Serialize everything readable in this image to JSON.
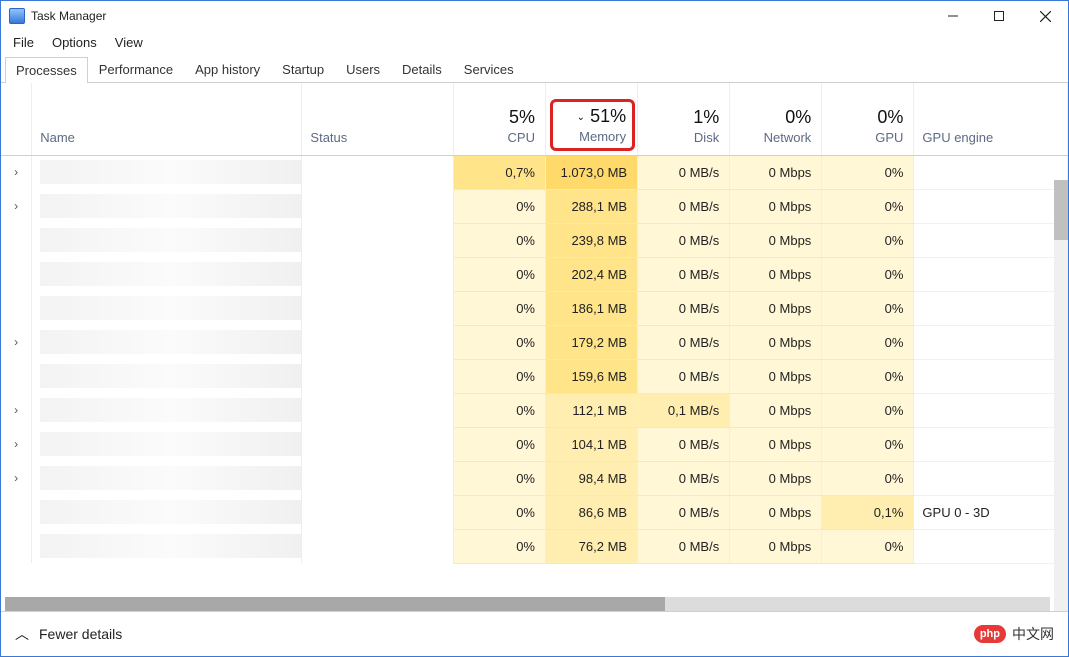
{
  "window": {
    "title": "Task Manager"
  },
  "menu": [
    "File",
    "Options",
    "View"
  ],
  "tabs": [
    "Processes",
    "Performance",
    "App history",
    "Startup",
    "Users",
    "Details",
    "Services"
  ],
  "active_tab": 0,
  "columns": {
    "name": {
      "label": "Name"
    },
    "status": {
      "label": "Status"
    },
    "cpu": {
      "usage": "5%",
      "label": "CPU"
    },
    "memory": {
      "usage": "51%",
      "label": "Memory",
      "sorted": true
    },
    "disk": {
      "usage": "1%",
      "label": "Disk"
    },
    "network": {
      "usage": "0%",
      "label": "Network"
    },
    "gpu": {
      "usage": "0%",
      "label": "GPU"
    },
    "engine": {
      "label": "GPU engine"
    }
  },
  "rows": [
    {
      "expand": true,
      "cpu": "0,7%",
      "mem": "1.073,0 MB",
      "disk": "0 MB/s",
      "net": "0 Mbps",
      "gpu": "0%",
      "eng": "",
      "h": {
        "cpu": "heat2",
        "mem": "heat3",
        "disk": "heat0",
        "net": "heat0",
        "gpu": "heat0"
      }
    },
    {
      "expand": true,
      "cpu": "0%",
      "mem": "288,1 MB",
      "disk": "0 MB/s",
      "net": "0 Mbps",
      "gpu": "0%",
      "eng": "",
      "h": {
        "cpu": "heat0",
        "mem": "heat2",
        "disk": "heat0",
        "net": "heat0",
        "gpu": "heat0"
      }
    },
    {
      "expand": false,
      "cpu": "0%",
      "mem": "239,8 MB",
      "disk": "0 MB/s",
      "net": "0 Mbps",
      "gpu": "0%",
      "eng": "",
      "h": {
        "cpu": "heat0",
        "mem": "heat2",
        "disk": "heat0",
        "net": "heat0",
        "gpu": "heat0"
      }
    },
    {
      "expand": false,
      "cpu": "0%",
      "mem": "202,4 MB",
      "disk": "0 MB/s",
      "net": "0 Mbps",
      "gpu": "0%",
      "eng": "",
      "h": {
        "cpu": "heat0",
        "mem": "heat2",
        "disk": "heat0",
        "net": "heat0",
        "gpu": "heat0"
      }
    },
    {
      "expand": false,
      "cpu": "0%",
      "mem": "186,1 MB",
      "disk": "0 MB/s",
      "net": "0 Mbps",
      "gpu": "0%",
      "eng": "",
      "h": {
        "cpu": "heat0",
        "mem": "heat2",
        "disk": "heat0",
        "net": "heat0",
        "gpu": "heat0"
      }
    },
    {
      "expand": true,
      "cpu": "0%",
      "mem": "179,2 MB",
      "disk": "0 MB/s",
      "net": "0 Mbps",
      "gpu": "0%",
      "eng": "",
      "h": {
        "cpu": "heat0",
        "mem": "heat2",
        "disk": "heat0",
        "net": "heat0",
        "gpu": "heat0"
      }
    },
    {
      "expand": false,
      "cpu": "0%",
      "mem": "159,6 MB",
      "disk": "0 MB/s",
      "net": "0 Mbps",
      "gpu": "0%",
      "eng": "",
      "h": {
        "cpu": "heat0",
        "mem": "heat2",
        "disk": "heat0",
        "net": "heat0",
        "gpu": "heat0"
      }
    },
    {
      "expand": true,
      "cpu": "0%",
      "mem": "112,1 MB",
      "disk": "0,1 MB/s",
      "net": "0 Mbps",
      "gpu": "0%",
      "eng": "",
      "h": {
        "cpu": "heat0",
        "mem": "heat1",
        "disk": "heat1",
        "net": "heat0",
        "gpu": "heat0"
      }
    },
    {
      "expand": true,
      "cpu": "0%",
      "mem": "104,1 MB",
      "disk": "0 MB/s",
      "net": "0 Mbps",
      "gpu": "0%",
      "eng": "",
      "h": {
        "cpu": "heat0",
        "mem": "heat1",
        "disk": "heat0",
        "net": "heat0",
        "gpu": "heat0"
      }
    },
    {
      "expand": true,
      "cpu": "0%",
      "mem": "98,4 MB",
      "disk": "0 MB/s",
      "net": "0 Mbps",
      "gpu": "0%",
      "eng": "",
      "h": {
        "cpu": "heat0",
        "mem": "heat1",
        "disk": "heat0",
        "net": "heat0",
        "gpu": "heat0"
      }
    },
    {
      "expand": false,
      "cpu": "0%",
      "mem": "86,6 MB",
      "disk": "0 MB/s",
      "net": "0 Mbps",
      "gpu": "0,1%",
      "eng": "GPU 0 - 3D",
      "h": {
        "cpu": "heat0",
        "mem": "heat1",
        "disk": "heat0",
        "net": "heat0",
        "gpu": "heat1"
      }
    },
    {
      "expand": false,
      "cpu": "0%",
      "mem": "76,2 MB",
      "disk": "0 MB/s",
      "net": "0 Mbps",
      "gpu": "0%",
      "eng": "",
      "h": {
        "cpu": "heat0",
        "mem": "heat1",
        "disk": "heat0",
        "net": "heat0",
        "gpu": "heat0"
      }
    }
  ],
  "footer": {
    "fewer": "Fewer details"
  },
  "brand": {
    "badge": "php",
    "text": "中文网"
  }
}
